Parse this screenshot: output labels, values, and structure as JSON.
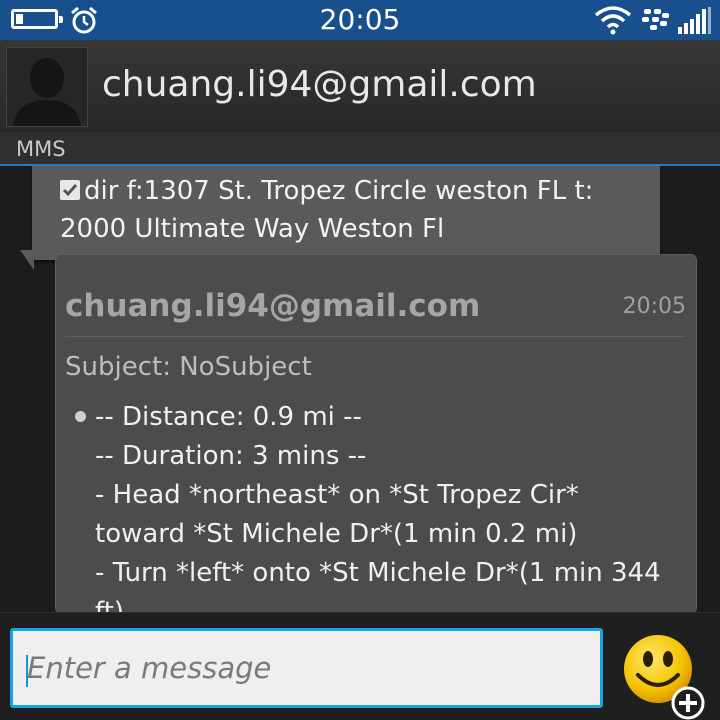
{
  "status_bar": {
    "time": "20:05",
    "icons": [
      "battery-icon",
      "alarm-icon",
      "wifi-icon",
      "bbm-icon",
      "signal-icon"
    ]
  },
  "header": {
    "contact": "chuang.li94@gmail.com",
    "avatar": "avatar-silhouette-icon"
  },
  "section": {
    "label": "MMS"
  },
  "conversation": {
    "sent": {
      "line1": "dir f:1307 St. Tropez Circle weston FL t:",
      "line2": "2000 Ultimate Way Weston Fl"
    },
    "received": {
      "sender": "chuang.li94@gmail.com",
      "time": "20:05",
      "subject": "Subject: NoSubject",
      "lines": [
        "-- Distance: 0.9 mi --",
        "-- Duration: 3 mins --",
        "- Head *northeast* on *St Tropez Cir*",
        "toward *St Michele Dr*(1 min 0.2 mi)",
        "- Turn *left* onto *St Michele Dr*(1 min 344",
        "ft)"
      ]
    }
  },
  "composer": {
    "placeholder": "Enter a message",
    "value": "",
    "emoticon_icon": "smiley-add-icon"
  },
  "colors": {
    "status_bar": "#17508d",
    "accent": "#14a5e0",
    "bubble": "#5a5a5a",
    "card": "#4c4c4c"
  }
}
